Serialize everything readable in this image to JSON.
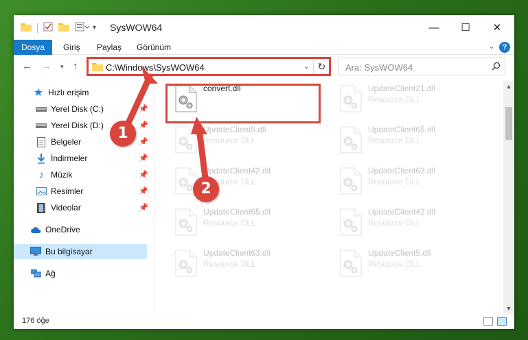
{
  "window": {
    "title": "SysWOW64",
    "controls": {
      "minimize": "—",
      "maximize": "☐",
      "close": "✕"
    }
  },
  "ribbon": {
    "tabs": [
      "Dosya",
      "Giriş",
      "Paylaş",
      "Görünüm"
    ],
    "help_label": "?"
  },
  "nav": {
    "address": "C:\\Windows\\SysWOW64",
    "search_placeholder": "Ara: SysWOW64"
  },
  "sidebar": {
    "quick_access": "Hızlı erişim",
    "items": [
      {
        "label": "Yerel Disk (C:)",
        "icon": "drive-icon"
      },
      {
        "label": "Yerel Disk (D:)",
        "icon": "drive-icon"
      },
      {
        "label": "Belgeler",
        "icon": "documents-icon"
      },
      {
        "label": "İndirmeler",
        "icon": "downloads-icon"
      },
      {
        "label": "Müzik",
        "icon": "music-icon"
      },
      {
        "label": "Resimler",
        "icon": "pictures-icon"
      },
      {
        "label": "Videolar",
        "icon": "videos-icon"
      }
    ],
    "onedrive": "OneDrive",
    "this_pc": "Bu bilgisayar",
    "network": "Ağ"
  },
  "files": [
    {
      "name": "convert.dll",
      "type": "",
      "faded": false
    },
    {
      "name": "UpdateClient21.dll",
      "type": "Resource DLL",
      "faded": true
    },
    {
      "name": "UpdateClient5.dll",
      "type": "Resource DLL",
      "faded": true
    },
    {
      "name": "UpdateClient65.dll",
      "type": "Resource DLL",
      "faded": true
    },
    {
      "name": "UpdateClient42.dll",
      "type": "Resource DLL",
      "faded": true
    },
    {
      "name": "UpdateClient63.dll",
      "type": "Resource DLL",
      "faded": true
    },
    {
      "name": "UpdateClient65.dll",
      "type": "Resource DLL",
      "faded": true
    },
    {
      "name": "UpdateClient42.dll",
      "type": "Resource DLL",
      "faded": true
    },
    {
      "name": "UpdateClient63.dll",
      "type": "Resource DLL",
      "faded": true
    },
    {
      "name": "UpdateClient5.dll",
      "type": "Resource DLL",
      "faded": true
    }
  ],
  "status": {
    "count": "176 öğe"
  },
  "annotations": {
    "step1": "1",
    "step2": "2"
  },
  "colors": {
    "accent": "#1979ca",
    "highlight": "#d9453c",
    "selected": "#cce8ff"
  }
}
